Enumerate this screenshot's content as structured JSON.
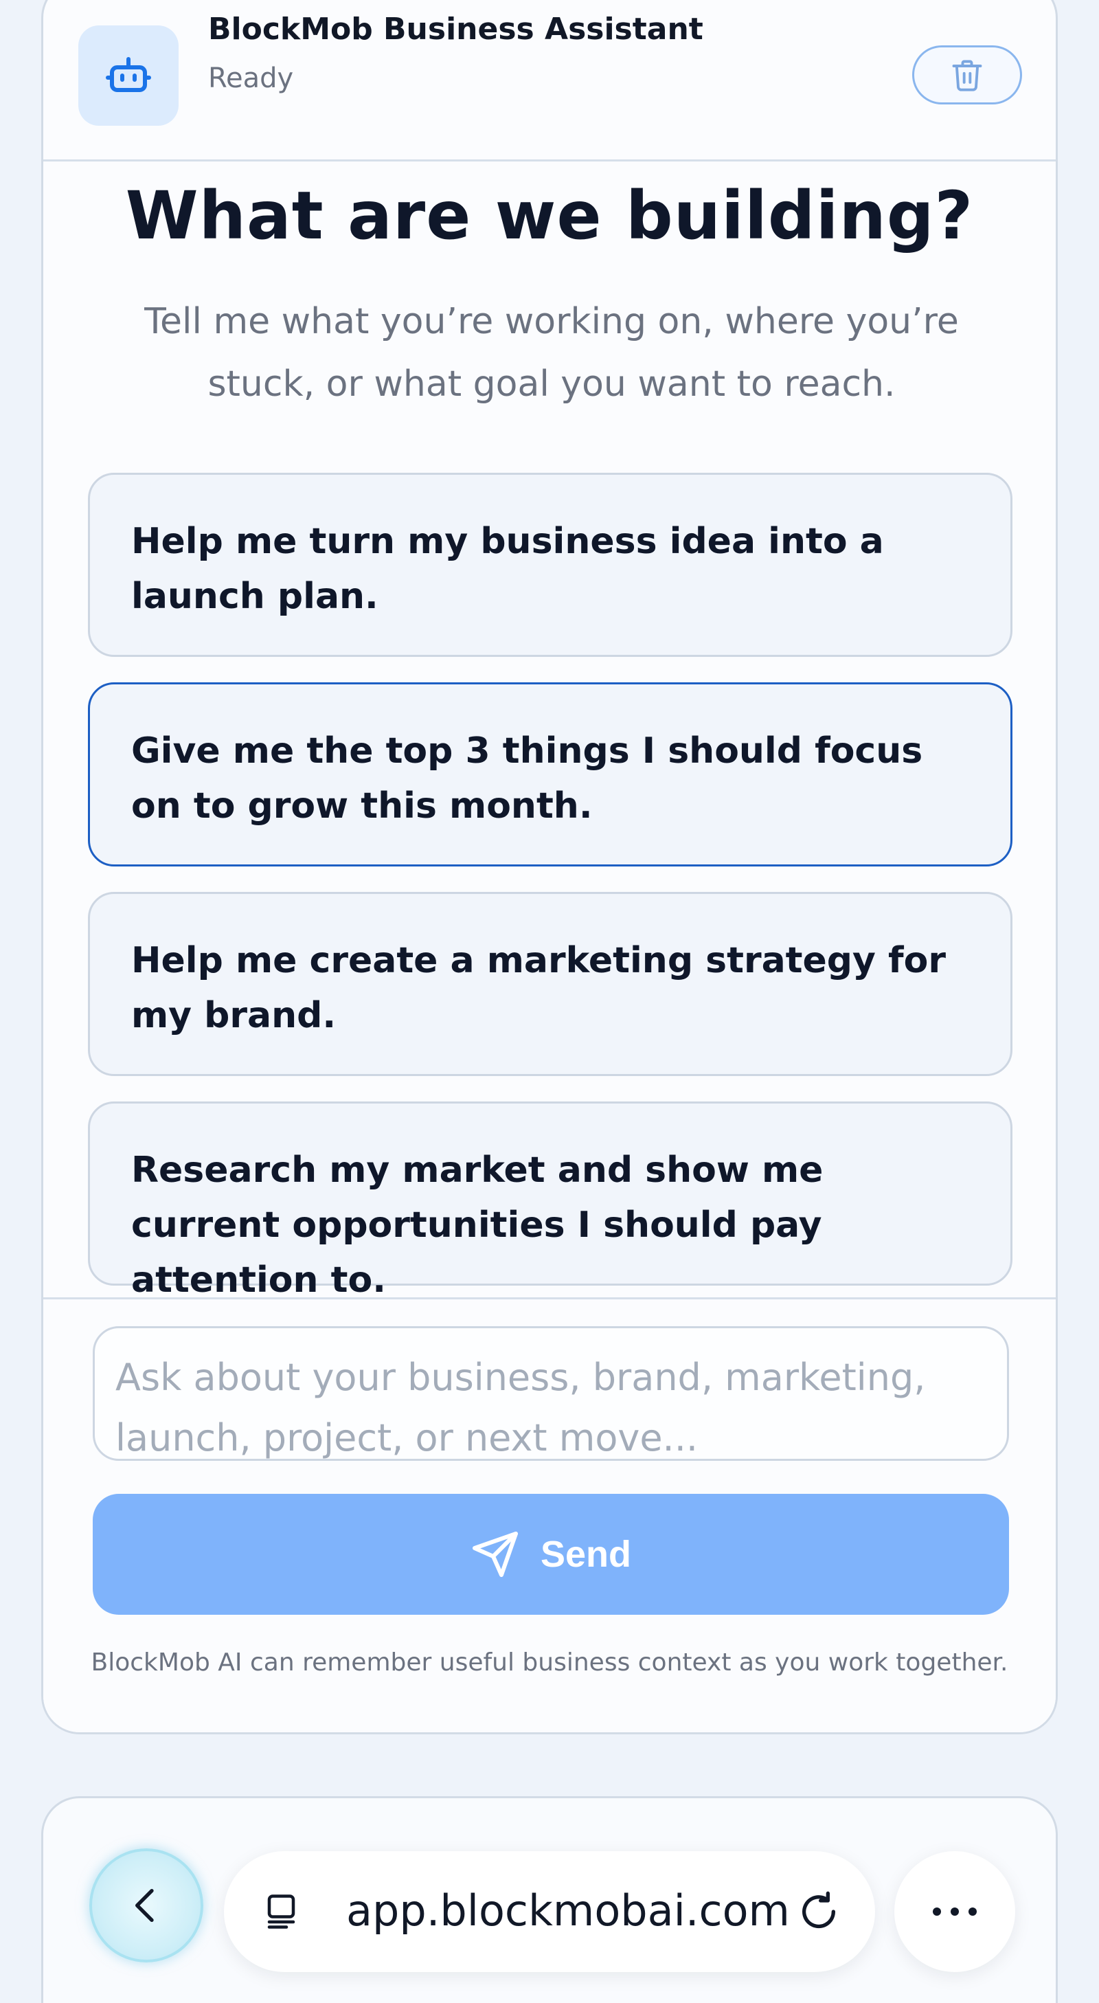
{
  "header": {
    "title": "BlockMob Business Assistant",
    "status": "Ready",
    "bot_icon": "robot-icon",
    "clear_icon": "trash-icon"
  },
  "hero": {
    "title": "What are we building?",
    "subtitle": "Tell me what you’re working on, where you’re stuck, or what goal you want to reach."
  },
  "suggestions": [
    {
      "label": "Help me turn my business idea into a launch plan."
    },
    {
      "label": "Give me the top 3 things I should focus on to grow this month."
    },
    {
      "label": "Help me create a marketing strategy for my brand."
    },
    {
      "label": "Research my market and show me current opportunities I should pay attention to."
    }
  ],
  "composer": {
    "placeholder": "Ask about your business, brand, marketing, launch, project, or next move...",
    "value": "",
    "send_label": "Send",
    "send_icon": "paper-plane-icon",
    "disclaimer": "BlockMob AI can remember useful business context as you work together."
  },
  "browser": {
    "url": "app.blockmobai.com",
    "back_icon": "chevron-left-icon",
    "tabs_icon": "tabs-icon",
    "reload_icon": "reload-icon",
    "more_icon": "more-horizontal-icon"
  },
  "colors": {
    "accent": "#1d5fc4",
    "send_button": "#7fb3fb",
    "avatar_bg": "#dcebfd",
    "page_bg": "#eef3fa"
  }
}
